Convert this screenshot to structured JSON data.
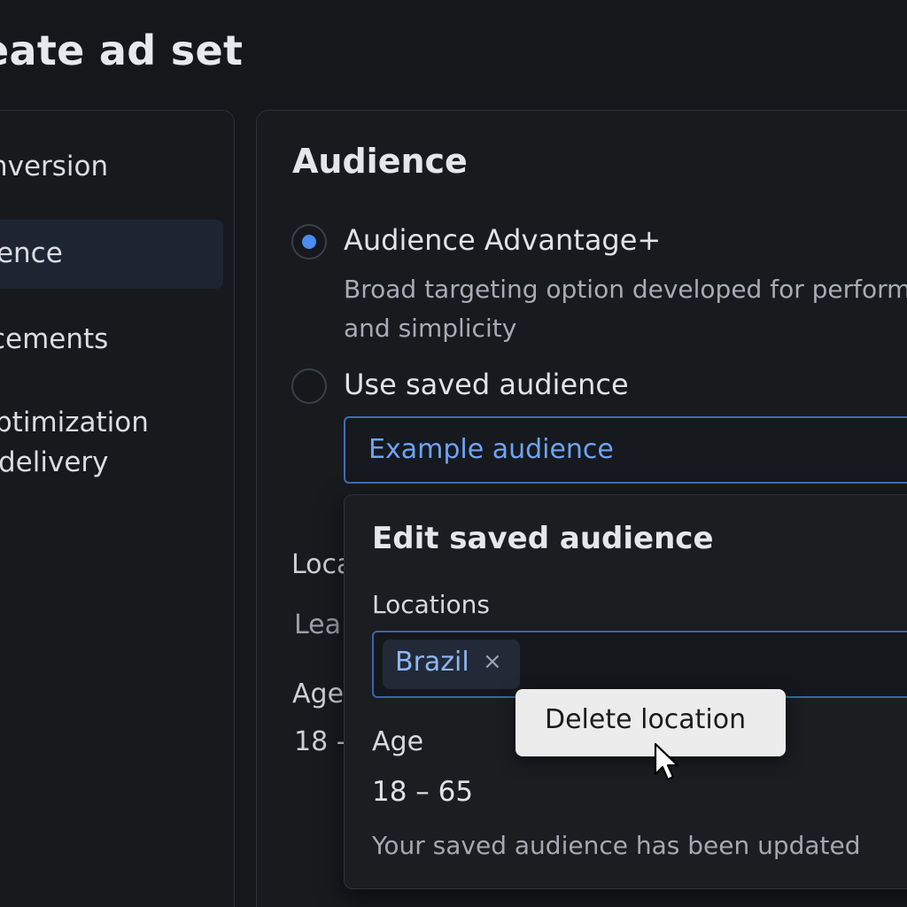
{
  "header": {
    "title": "reate ad set"
  },
  "nav": {
    "items": [
      {
        "label": "onversion"
      },
      {
        "label": "udience"
      },
      {
        "label": "acements"
      },
      {
        "label": "ptimization"
      },
      {
        "label": "delivery"
      }
    ]
  },
  "audience": {
    "title": "Audience",
    "options": [
      {
        "label": "Audience Advantage+",
        "description_line1": "Broad targeting option developed for performa",
        "description_line2": "and simplicity",
        "checked": true
      },
      {
        "label": "Use saved audience",
        "checked": false
      }
    ],
    "saved_audience_select": {
      "value": "Example audience"
    },
    "background": {
      "locations_fragment": "Loca",
      "lead_fragment": "Lea",
      "age_fragment": "Age",
      "age_value_fragment": "18 -"
    }
  },
  "edit_popover": {
    "title": "Edit saved audience",
    "locations_label": "Locations",
    "location_chip": {
      "label": "Brazil",
      "remove_glyph": "×"
    },
    "age_label": "Age",
    "age_value": "18 – 65",
    "status_message": "Your saved audience has been updated"
  },
  "tooltip": {
    "label": "Delete location"
  },
  "colors": {
    "accent": "#4a8cf0",
    "select_text": "#6fa3f5",
    "background": "#15171b"
  }
}
